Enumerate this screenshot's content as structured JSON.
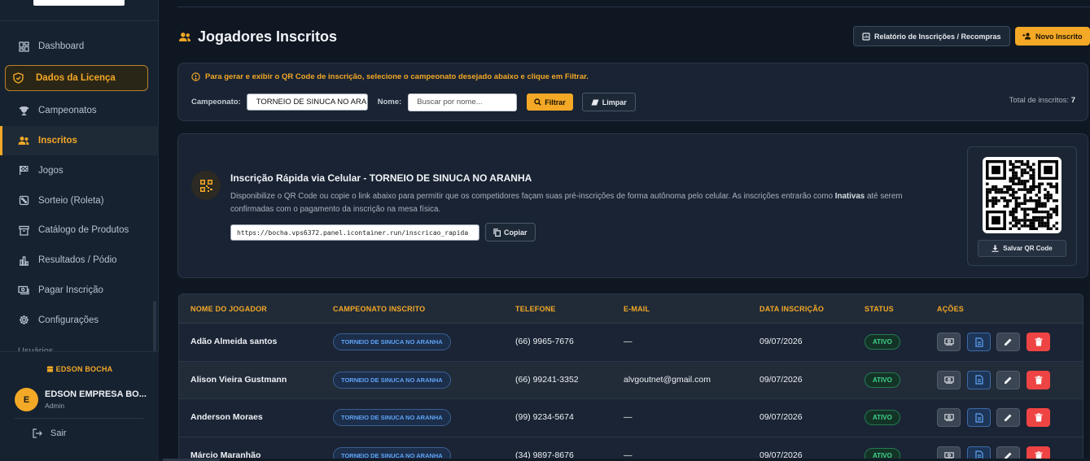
{
  "sidebar": {
    "items": [
      {
        "label": "Dashboard",
        "icon": "dashboard-icon"
      },
      {
        "label": "Dados da Licença",
        "icon": "shield-icon"
      },
      {
        "label": "Campeonatos",
        "icon": "trophy-icon"
      },
      {
        "label": "Inscritos",
        "icon": "users-icon"
      },
      {
        "label": "Jogos",
        "icon": "flag-icon"
      },
      {
        "label": "Sorteio (Roleta)",
        "icon": "dice-icon"
      },
      {
        "label": "Catálogo de Produtos",
        "icon": "archive-icon"
      },
      {
        "label": "Resultados / Pódio",
        "icon": "bar-chart-icon"
      },
      {
        "label": "Pagar Inscrição",
        "icon": "cash-icon"
      },
      {
        "label": "Configurações",
        "icon": "gear-icon"
      }
    ],
    "partial_item": "Usuários",
    "company": "EDSON BOCHA",
    "user": {
      "initial": "E",
      "name": "EDSON EMPRESA BO...",
      "role": "Admin"
    },
    "logout": "Sair"
  },
  "header": {
    "title": "Jogadores Inscritos",
    "report_button": "Relatório de Inscrições / Recompras",
    "new_button": "Novo Inscrito"
  },
  "filter": {
    "info_text": "Para gerar e exibir o QR Code de inscrição, selecione o campeonato desejado abaixo e clique em Filtrar.",
    "campeonato_label": "Campeonato:",
    "campeonato_value": "TORNEIO DE SINUCA NO ARANHA",
    "nome_label": "Nome:",
    "nome_placeholder": "Buscar por nome...",
    "filtrar_button": "Filtrar",
    "limpar_button": "Limpar",
    "total_label": "Total de inscritos:",
    "total_value": "7"
  },
  "quick": {
    "title": "Inscrição Rápida via Celular - TORNEIO DE SINUCA NO ARANHA",
    "desc_part1": "Disponibilize o QR Code ou copie o link abaixo para permitir que os competidores façam suas pré-inscrições de forma autônoma pelo celular. As inscrições entrarão como ",
    "desc_bold": "Inativas",
    "desc_part2": " até serem confirmadas com o pagamento da inscrição na mesa física.",
    "link": "https://bocha.vps6372.panel.icontainer.run/inscricao_rapida",
    "copy_button": "Copiar",
    "save_qr_button": "Salvar QR Code"
  },
  "table": {
    "headers": [
      "NOME DO JOGADOR",
      "CAMPEONATO INSCRITO",
      "TELEFONE",
      "E-MAIL",
      "DATA INSCRIÇÃO",
      "STATUS",
      "AÇÕES"
    ],
    "rows": [
      {
        "name": "Adão Almeida santos",
        "campeonato": "TORNEIO DE SINUCA NO ARANHA",
        "telefone": "(66) 9965-7676",
        "email": "—",
        "data": "09/07/2026",
        "status": "ATIVO"
      },
      {
        "name": "Alison Vieira Gustmann",
        "campeonato": "TORNEIO DE SINUCA NO ARANHA",
        "telefone": "(66) 99241-3352",
        "email": "alvgoutnet@gmail.com",
        "data": "09/07/2026",
        "status": "ATIVO"
      },
      {
        "name": "Anderson Moraes",
        "campeonato": "TORNEIO DE SINUCA NO ARANHA",
        "telefone": "(99) 9234-5674",
        "email": "—",
        "data": "09/07/2026",
        "status": "ATIVO"
      },
      {
        "name": "Márcio Maranhão",
        "campeonato": "TORNEIO DE SINUCA NO ARANHA",
        "telefone": "(34) 9897-8676",
        "email": "—",
        "data": "09/07/2026",
        "status": "ATIVO"
      }
    ]
  },
  "colors": {
    "accent": "#f3a826",
    "danger": "#ef4444",
    "success": "#3fd18a",
    "info": "#5fa3f5"
  }
}
